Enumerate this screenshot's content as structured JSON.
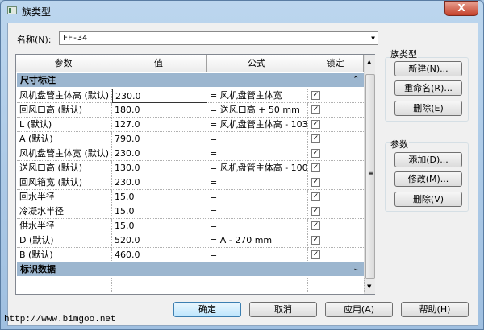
{
  "window": {
    "title": "族类型",
    "close": "X"
  },
  "name_label": "名称(N):",
  "name_value": "FF-34",
  "columns": [
    "参数",
    "值",
    "公式",
    "锁定"
  ],
  "groups": [
    {
      "label": "尺寸标注",
      "chevron": "⌃",
      "rows": [
        {
          "param": "风机盘管主体高 (默认)",
          "value": "230.0",
          "formula": "= 风机盘管主体宽",
          "locked": true
        },
        {
          "param": "回风口高 (默认)",
          "value": "180.0",
          "formula": "= 送风口高 + 50 mm",
          "locked": true
        },
        {
          "param": "L (默认)",
          "value": "127.0",
          "formula": "= 风机盘管主体高 - 103",
          "locked": true
        },
        {
          "param": "A (默认)",
          "value": "790.0",
          "formula": "=",
          "locked": true
        },
        {
          "param": "风机盘管主体宽 (默认)",
          "value": "230.0",
          "formula": "=",
          "locked": true
        },
        {
          "param": "送风口高 (默认)",
          "value": "130.0",
          "formula": "= 风机盘管主体高 - 100",
          "locked": true
        },
        {
          "param": "回风箱宽 (默认)",
          "value": "230.0",
          "formula": "=",
          "locked": true
        },
        {
          "param": "回水半径",
          "value": "15.0",
          "formula": "=",
          "locked": true
        },
        {
          "param": "冷凝水半径",
          "value": "15.0",
          "formula": "=",
          "locked": true
        },
        {
          "param": "供水半径",
          "value": "15.0",
          "formula": "=",
          "locked": true
        },
        {
          "param": "D (默认)",
          "value": "520.0",
          "formula": "= A - 270 mm",
          "locked": true
        },
        {
          "param": "B (默认)",
          "value": "460.0",
          "formula": "=",
          "locked": true
        }
      ]
    },
    {
      "label": "标识数据",
      "chevron": "⌄",
      "rows": []
    }
  ],
  "family_types": {
    "label": "族类型",
    "new": "新建(N)...",
    "rename": "重命名(R)...",
    "delete": "删除(E)"
  },
  "parameters": {
    "label": "参数",
    "add": "添加(D)...",
    "modify": "修改(M)...",
    "delete": "删除(V)"
  },
  "footer": {
    "ok": "确定",
    "cancel": "取消",
    "apply": "应用(A)",
    "help": "帮助(H)"
  },
  "watermark": "http://www.bimgoo.net"
}
